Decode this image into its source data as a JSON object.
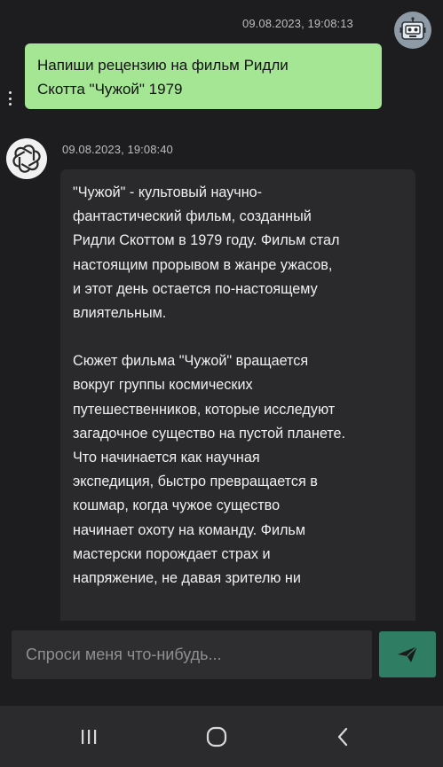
{
  "user_message": {
    "timestamp": "09.08.2023, 19:08:13",
    "lines": [
      "Напиши рецензию на фильм Ридли",
      "Скотта \"Чужой\" 1979"
    ]
  },
  "assistant_message": {
    "timestamp": "09.08.2023, 19:08:40",
    "paragraph1": [
      "\"Чужой\" - культовый научно-",
      "фантастический фильм, созданный",
      "Ридли Скоттом в 1979 году. Фильм стал",
      "настоящим прорывом в жанре ужасов,",
      "и этот день остается по-настоящему",
      "влиятельным."
    ],
    "paragraph2": [
      "Сюжет фильма \"Чужой\" вращается",
      "вокруг группы космических",
      "путешественников, которые исследуют",
      "загадочное существо на пустой планете.",
      "Что начинается как научная",
      "экспедиция, быстро превращается в",
      "кошмар, когда чужое существо",
      "начинает охоту на команду. Фильм",
      "мастерски порождает страх и",
      "напряжение, не давая зрителю ни"
    ]
  },
  "composer": {
    "placeholder": "Спроси меня что-нибудь..."
  },
  "colors": {
    "background": "#1d1d1f",
    "user_bubble": "#a4e694",
    "assistant_bubble": "#2a2a2c",
    "send_button": "#2f7d63",
    "nav_bar": "#2b2b2d"
  },
  "icons": {
    "user_avatar": "robot-icon",
    "assistant_avatar": "openai-logo-icon",
    "send": "send-icon",
    "nav_recent": "recent-apps-icon",
    "nav_home": "home-icon",
    "nav_back": "back-icon",
    "more": "more-vertical-icon"
  }
}
